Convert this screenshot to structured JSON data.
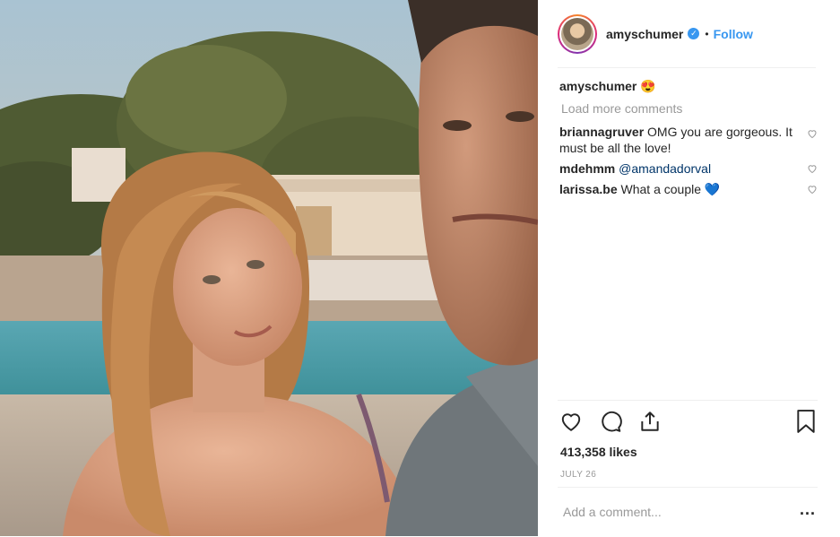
{
  "header": {
    "username": "amyschumer",
    "verified_icon": "verified-badge-icon",
    "separator": "•",
    "follow_label": "Follow"
  },
  "caption": {
    "username": "amyschumer",
    "text": "😍"
  },
  "load_more_label": "Load more comments",
  "comments": [
    {
      "username": "briannagruver",
      "text": "OMG you are gorgeous. It must be all the love!",
      "mention": ""
    },
    {
      "username": "mdehmm",
      "text": "",
      "mention": "@amandadorval"
    },
    {
      "username": "larissa.be",
      "text": "What a couple 💙",
      "mention": ""
    }
  ],
  "actions": {
    "like_icon": "heart-icon",
    "comment_icon": "comment-icon",
    "share_icon": "share-icon",
    "save_icon": "bookmark-icon"
  },
  "likes_text": "413,358 likes",
  "date_text": "JULY 26",
  "add_comment": {
    "placeholder": "Add a comment...",
    "more_label": "..."
  },
  "colors": {
    "link_blue": "#3897f0",
    "mention_blue": "#003569",
    "muted": "#999999",
    "text": "#262626"
  }
}
